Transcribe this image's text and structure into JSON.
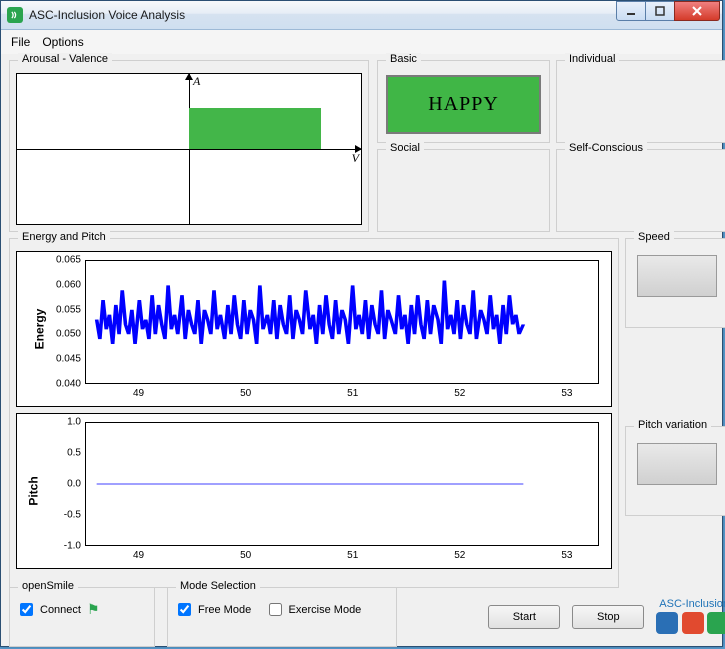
{
  "window": {
    "title": "ASC-Inclusion Voice Analysis"
  },
  "menu": {
    "file": "File",
    "options": "Options"
  },
  "arousal_valence": {
    "title": "Arousal - Valence",
    "axis_a": "A",
    "axis_v": "V",
    "rect": {
      "v0": 0.0,
      "v1": 0.77,
      "a0": 0.0,
      "a1": 0.55
    }
  },
  "emotions": {
    "basic": {
      "title": "Basic",
      "value": "HAPPY",
      "color": "#40b646"
    },
    "individual": {
      "title": "Individual",
      "value": ""
    },
    "social": {
      "title": "Social",
      "value": ""
    },
    "self_conscious": {
      "title": "Self-Conscious",
      "value": ""
    }
  },
  "energy_pitch": {
    "title": "Energy and Pitch"
  },
  "speed": {
    "title": "Speed"
  },
  "pitch_variation": {
    "title": "Pitch variation"
  },
  "opensmile": {
    "title": "openSmile",
    "connect_label": "Connect",
    "connect_checked": true
  },
  "mode": {
    "title": "Mode Selection",
    "free_label": "Free Mode",
    "free_checked": true,
    "exercise_label": "Exercise Mode",
    "exercise_checked": false
  },
  "buttons": {
    "start": "Start",
    "stop": "Stop"
  },
  "brand": "ASC-Inclusion",
  "chart_data": [
    {
      "type": "line",
      "title": "",
      "xlabel": "",
      "ylabel": "Energy",
      "xlim": [
        48.5,
        53.3
      ],
      "ylim": [
        0.04,
        0.065
      ],
      "xticks": [
        49,
        50,
        51,
        52,
        53
      ],
      "yticks": [
        0.04,
        0.045,
        0.05,
        0.055,
        0.06,
        0.065
      ],
      "x": [
        48.6,
        48.63,
        48.66,
        48.69,
        48.72,
        48.75,
        48.78,
        48.81,
        48.84,
        48.87,
        48.9,
        48.93,
        48.96,
        49.0,
        49.03,
        49.06,
        49.09,
        49.12,
        49.15,
        49.18,
        49.21,
        49.24,
        49.27,
        49.3,
        49.33,
        49.36,
        49.4,
        49.43,
        49.46,
        49.49,
        49.52,
        49.55,
        49.58,
        49.61,
        49.64,
        49.67,
        49.7,
        49.73,
        49.76,
        49.8,
        49.83,
        49.86,
        49.89,
        49.92,
        49.95,
        49.98,
        50.01,
        50.04,
        50.07,
        50.1,
        50.13,
        50.16,
        50.2,
        50.23,
        50.26,
        50.29,
        50.32,
        50.35,
        50.38,
        50.41,
        50.44,
        50.47,
        50.5,
        50.53,
        50.56,
        50.6,
        50.63,
        50.66,
        50.69,
        50.72,
        50.75,
        50.78,
        50.81,
        50.84,
        50.87,
        50.9,
        50.93,
        50.96,
        51.0,
        51.03,
        51.06,
        51.09,
        51.12,
        51.15,
        51.18,
        51.21,
        51.24,
        51.27,
        51.3,
        51.33,
        51.36,
        51.4,
        51.43,
        51.46,
        51.49,
        51.52,
        51.55,
        51.58,
        51.61,
        51.64,
        51.67,
        51.7,
        51.73,
        51.76,
        51.8,
        51.83,
        51.86,
        51.89,
        51.92,
        51.95,
        51.98,
        52.01,
        52.04,
        52.07,
        52.1,
        52.13,
        52.16,
        52.2,
        52.23,
        52.26,
        52.29,
        52.32,
        52.35,
        52.38,
        52.41,
        52.44,
        52.47,
        52.5,
        52.53,
        52.56,
        52.6
      ],
      "values": [
        0.053,
        0.049,
        0.057,
        0.051,
        0.054,
        0.048,
        0.056,
        0.05,
        0.059,
        0.052,
        0.05,
        0.055,
        0.048,
        0.057,
        0.051,
        0.053,
        0.049,
        0.058,
        0.05,
        0.056,
        0.052,
        0.049,
        0.06,
        0.051,
        0.054,
        0.05,
        0.058,
        0.049,
        0.055,
        0.052,
        0.05,
        0.057,
        0.048,
        0.055,
        0.053,
        0.05,
        0.059,
        0.051,
        0.054,
        0.049,
        0.056,
        0.05,
        0.058,
        0.052,
        0.049,
        0.057,
        0.05,
        0.055,
        0.053,
        0.048,
        0.06,
        0.051,
        0.054,
        0.05,
        0.057,
        0.049,
        0.056,
        0.052,
        0.05,
        0.058,
        0.049,
        0.055,
        0.053,
        0.05,
        0.059,
        0.051,
        0.054,
        0.048,
        0.056,
        0.05,
        0.058,
        0.052,
        0.049,
        0.057,
        0.05,
        0.055,
        0.053,
        0.048,
        0.06,
        0.051,
        0.054,
        0.05,
        0.057,
        0.049,
        0.056,
        0.052,
        0.05,
        0.059,
        0.049,
        0.055,
        0.053,
        0.05,
        0.058,
        0.051,
        0.054,
        0.048,
        0.056,
        0.05,
        0.058,
        0.052,
        0.049,
        0.057,
        0.05,
        0.056,
        0.053,
        0.048,
        0.061,
        0.051,
        0.054,
        0.05,
        0.057,
        0.049,
        0.056,
        0.052,
        0.05,
        0.059,
        0.049,
        0.055,
        0.053,
        0.05,
        0.058,
        0.051,
        0.054,
        0.048,
        0.056,
        0.05,
        0.058,
        0.052,
        0.054,
        0.05,
        0.052
      ]
    },
    {
      "type": "line",
      "title": "",
      "xlabel": "",
      "ylabel": "Pitch",
      "xlim": [
        48.5,
        53.3
      ],
      "ylim": [
        -1.0,
        1.0
      ],
      "xticks": [
        49,
        50,
        51,
        52,
        53
      ],
      "yticks": [
        -1.0,
        -0.5,
        0.0,
        0.5,
        1.0
      ],
      "x": [
        48.6,
        52.6
      ],
      "values": [
        0.0,
        0.0
      ]
    }
  ]
}
